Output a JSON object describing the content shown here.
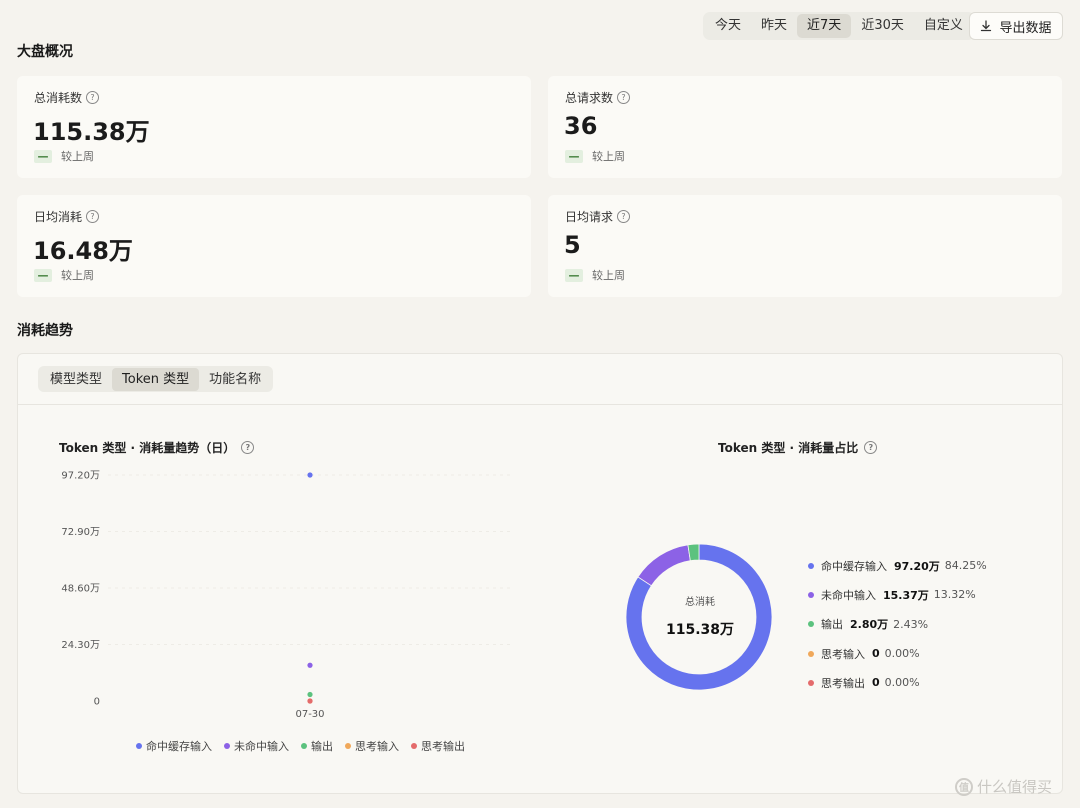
{
  "header": {
    "ranges": [
      {
        "label": "今天",
        "active": false
      },
      {
        "label": "昨天",
        "active": false
      },
      {
        "label": "近7天",
        "active": true
      },
      {
        "label": "近30天",
        "active": false
      },
      {
        "label": "自定义",
        "active": false
      }
    ],
    "export_label": "导出数据"
  },
  "overview": {
    "title": "大盘概况",
    "cards": [
      {
        "label": "总消耗数",
        "value": "115.38万",
        "compare": "较上周",
        "badge": "—"
      },
      {
        "label": "总请求数",
        "value": "36",
        "compare": "较上周",
        "badge": "—"
      },
      {
        "label": "日均消耗",
        "value": "16.48万",
        "compare": "较上周",
        "badge": "—"
      },
      {
        "label": "日均请求",
        "value": "5",
        "compare": "较上周",
        "badge": "—"
      }
    ]
  },
  "trend": {
    "title": "消耗趋势",
    "tabs": [
      {
        "label": "模型类型",
        "active": false
      },
      {
        "label": "Token 类型",
        "active": true
      },
      {
        "label": "功能名称",
        "active": false
      }
    ]
  },
  "colors": {
    "hit_cache": "#6673ee",
    "miss_cache": "#8c62e6",
    "output": "#5cc27e",
    "think_input": "#f0a85a",
    "think_output": "#e46b6b"
  },
  "chart_data": [
    {
      "type": "scatter",
      "title": "Token 类型 · 消耗量趋势（日）",
      "x": [
        "07-30"
      ],
      "ylim": [
        0,
        97.2
      ],
      "yticks": [
        "0",
        "24.30万",
        "48.60万",
        "72.90万",
        "97.20万"
      ],
      "grid": true,
      "legend": "bottom",
      "series": [
        {
          "name": "命中缓存输入",
          "values": [
            97.2
          ],
          "color": "#6673ee"
        },
        {
          "name": "未命中输入",
          "values": [
            15.37
          ],
          "color": "#8c62e6"
        },
        {
          "name": "输出",
          "values": [
            2.8
          ],
          "color": "#5cc27e"
        },
        {
          "name": "思考输入",
          "values": [
            0
          ],
          "color": "#f0a85a"
        },
        {
          "name": "思考输出",
          "values": [
            0
          ],
          "color": "#e46b6b"
        }
      ]
    },
    {
      "type": "pie",
      "title": "Token 类型 · 消耗量占比",
      "center_label": "总消耗",
      "center_value": "115.38万",
      "legend": "right",
      "slices": [
        {
          "name": "命中缓存输入",
          "value": 97.2,
          "value_label": "97.20万",
          "percent": "84.25%",
          "color": "#6673ee"
        },
        {
          "name": "未命中输入",
          "value": 15.37,
          "value_label": "15.37万",
          "percent": "13.32%",
          "color": "#8c62e6"
        },
        {
          "name": "输出",
          "value": 2.8,
          "value_label": "2.80万",
          "percent": "2.43%",
          "color": "#5cc27e"
        },
        {
          "name": "思考输入",
          "value": 0,
          "value_label": "0",
          "percent": "0.00%",
          "color": "#f0a85a"
        },
        {
          "name": "思考输出",
          "value": 0,
          "value_label": "0",
          "percent": "0.00%",
          "color": "#e46b6b"
        }
      ]
    }
  ],
  "watermark": {
    "text": "什么值得买",
    "logo_glyph": "值"
  }
}
